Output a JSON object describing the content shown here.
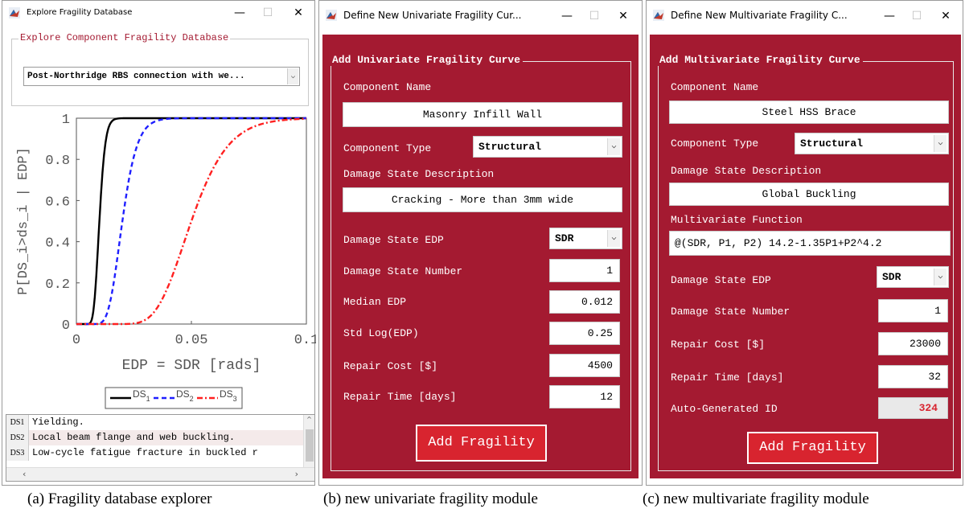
{
  "window_a": {
    "title": "Explore Fragility Database",
    "minimize": "—",
    "maximize": "☐",
    "close": "✕",
    "group_title": "Explore Component Fragility Database",
    "dropdown_value": "Post-Northridge RBS connection with we...",
    "chart": {
      "ylabel": "P[DS_i>ds_i | EDP]",
      "xlabel": "EDP = SDR [rads]",
      "xticks": [
        "0",
        "0.05",
        "0.1"
      ],
      "yticks": [
        "0",
        "0.2",
        "0.4",
        "0.6",
        "0.8",
        "1"
      ]
    },
    "list": [
      {
        "id": "DS1",
        "text": "Yielding."
      },
      {
        "id": "DS2",
        "text": "Local beam flange and web buckling."
      },
      {
        "id": "DS3",
        "text": "Low-cycle fatigue fracture in buckled r"
      }
    ],
    "caption": "(a) Fragility database explorer"
  },
  "chart_data": {
    "type": "line",
    "xlabel": "EDP = SDR [rads]",
    "ylabel": "P[DS_i>ds_i | EDP]",
    "xlim": [
      0,
      0.1
    ],
    "ylim": [
      0,
      1
    ],
    "grid": false,
    "legend_position": "bottom",
    "series": [
      {
        "name": "DS1",
        "color": "#000000",
        "style": "solid",
        "median": 0.01,
        "beta": 0.2
      },
      {
        "name": "DS2",
        "color": "#1f1fff",
        "style": "dashed",
        "median": 0.02,
        "beta": 0.25
      },
      {
        "name": "DS3",
        "color": "#ff2020",
        "style": "dashdot",
        "median": 0.05,
        "beta": 0.25
      }
    ]
  },
  "window_b": {
    "title": "Define New Univariate Fragility Cur...",
    "minimize": "—",
    "maximize": "☐",
    "close": "✕",
    "group_title": "Add Univariate Fragility Curve",
    "component_name_label": "Component Name",
    "component_name_value": "Masonry Infill Wall",
    "component_type_label": "Component Type",
    "component_type_value": "Structural",
    "ds_desc_label": "Damage State Description",
    "ds_desc_value": "Cracking - More than 3mm wide",
    "ds_edp_label": "Damage State EDP",
    "ds_edp_value": "SDR",
    "ds_number_label": "Damage State Number",
    "ds_number_value": "1",
    "median_label": "Median EDP",
    "median_value": "0.012",
    "std_label": "Std Log(EDP)",
    "std_value": "0.25",
    "repair_cost_label": "Repair Cost [$]",
    "repair_cost_value": "4500",
    "repair_time_label": "Repair Time [days]",
    "repair_time_value": "12",
    "add_button": "Add Fragility",
    "caption": "(b) new univariate fragility module"
  },
  "window_c": {
    "title": "Define New Multivariate Fragility C...",
    "minimize": "—",
    "maximize": "☐",
    "close": "✕",
    "group_title": "Add Multivariate Fragility Curve",
    "component_name_label": "Component Name",
    "component_name_value": "Steel HSS Brace",
    "component_type_label": "Component Type",
    "component_type_value": "Structural",
    "ds_desc_label": "Damage State Description",
    "ds_desc_value": "Global Buckling",
    "mv_func_label": "Multivariate Function",
    "mv_func_value": "@(SDR, P1, P2) 14.2-1.35P1+P2^4.2",
    "ds_edp_label": "Damage State EDP",
    "ds_edp_value": "SDR",
    "ds_number_label": "Damage State Number",
    "ds_number_value": "1",
    "repair_cost_label": "Repair Cost [$]",
    "repair_cost_value": "23000",
    "repair_time_label": "Repair Time [days]",
    "repair_time_value": "32",
    "autoid_label": "Auto-Generated ID",
    "autoid_value": "324",
    "add_button": "Add Fragility",
    "caption": "(c) new multivariate fragility module"
  }
}
